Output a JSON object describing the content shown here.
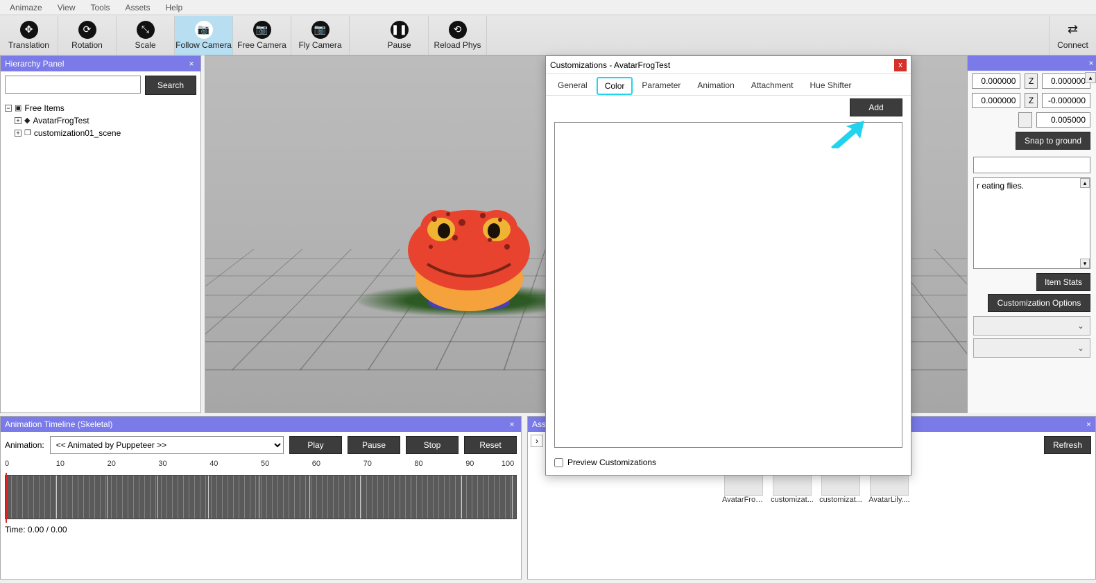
{
  "menu": {
    "items": [
      "Animaze",
      "View",
      "Tools",
      "Assets",
      "Help"
    ]
  },
  "toolbar": {
    "buttons": [
      {
        "label": "Translation"
      },
      {
        "label": "Rotation"
      },
      {
        "label": "Scale"
      },
      {
        "label": "Follow Camera",
        "active": true
      },
      {
        "label": "Free Camera"
      },
      {
        "label": "Fly Camera"
      },
      {
        "label": "Pause"
      },
      {
        "label": "Reload Phys"
      }
    ],
    "connect": "Connect"
  },
  "hierarchy": {
    "title": "Hierarchy Panel",
    "search_btn": "Search",
    "items": {
      "root": "Free Items",
      "child1": "AvatarFrogTest",
      "child2": "customization01_scene"
    }
  },
  "right": {
    "row1": {
      "axis": "Z",
      "val": "0.000000",
      "val_partial": "0.000000"
    },
    "row2": {
      "axis": "Z",
      "val": "-0.000000",
      "val_partial": "0.000000"
    },
    "row3": {
      "val": "0.005000"
    },
    "snap": "Snap to ground",
    "desc": "r eating flies.",
    "item_stats": "Item Stats",
    "cust_opts": "Customization Options"
  },
  "anim": {
    "title": "Animation Timeline (Skeletal)",
    "label": "Animation:",
    "selected": "<< Animated by Puppeteer >>",
    "play": "Play",
    "pause": "Pause",
    "stop": "Stop",
    "reset": "Reset",
    "ticks": [
      "0",
      "10",
      "20",
      "30",
      "40",
      "50",
      "60",
      "70",
      "80",
      "90",
      "100"
    ],
    "time": "Time: 0.00 / 0.00"
  },
  "assets": {
    "title": "Asse",
    "refresh": "Refresh",
    "thumbs": [
      "..",
      "AvatarFrog...",
      "customizat...",
      "customizat...",
      "AvatarLily...."
    ]
  },
  "modal": {
    "title": "Customizations - AvatarFrogTest",
    "tabs": [
      "General",
      "Color",
      "Parameter",
      "Animation",
      "Attachment",
      "Hue Shifter"
    ],
    "active_tab": "Color",
    "add": "Add",
    "preview": "Preview Customizations"
  }
}
